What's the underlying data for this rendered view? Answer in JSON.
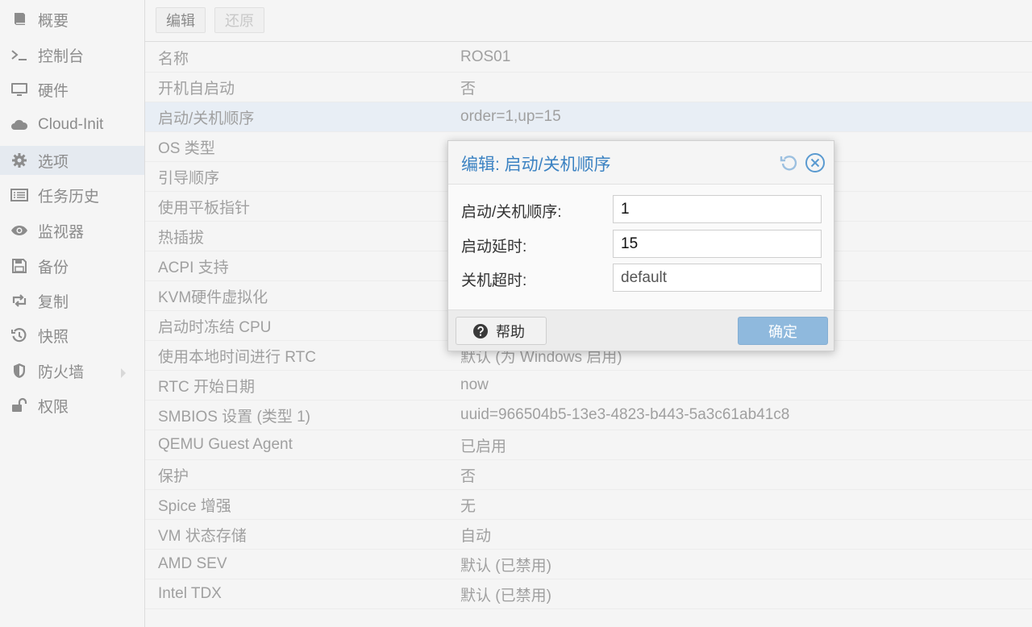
{
  "colors": {
    "accent": "#3b82c2",
    "selected_row": "#e8eef5",
    "selected_nav": "#e5eaf0",
    "ok_button": "#8fb9dd",
    "muted_text": "#a0a0a0"
  },
  "sidebar": {
    "items": [
      {
        "label": "概要",
        "icon": "book-icon"
      },
      {
        "label": "控制台",
        "icon": "terminal-icon"
      },
      {
        "label": "硬件",
        "icon": "monitor-icon"
      },
      {
        "label": "Cloud-Init",
        "icon": "cloud-icon"
      },
      {
        "label": "选项",
        "icon": "gear-icon",
        "selected": true
      },
      {
        "label": "任务历史",
        "icon": "list-icon"
      },
      {
        "label": "监视器",
        "icon": "eye-icon"
      },
      {
        "label": "备份",
        "icon": "floppy-icon"
      },
      {
        "label": "复制",
        "icon": "retweet-icon"
      },
      {
        "label": "快照",
        "icon": "history-icon"
      },
      {
        "label": "防火墙",
        "icon": "shield-icon",
        "has_submenu": true
      },
      {
        "label": "权限",
        "icon": "unlock-icon"
      }
    ]
  },
  "toolbar": {
    "edit_label": "编辑",
    "revert_label": "还原"
  },
  "options": {
    "rows": [
      {
        "key": "名称",
        "value": "ROS01"
      },
      {
        "key": "开机自启动",
        "value": "否"
      },
      {
        "key": "启动/关机顺序",
        "value": "order=1,up=15",
        "selected": true
      },
      {
        "key": "OS 类型",
        "value": ""
      },
      {
        "key": "引导顺序",
        "value": ""
      },
      {
        "key": "使用平板指针",
        "value": ""
      },
      {
        "key": "热插拔",
        "value": ""
      },
      {
        "key": "ACPI 支持",
        "value": ""
      },
      {
        "key": "KVM硬件虚拟化",
        "value": ""
      },
      {
        "key": "启动时冻结 CPU",
        "value": ""
      },
      {
        "key": "使用本地时间进行 RTC",
        "value": "默认 (为 Windows 启用)"
      },
      {
        "key": "RTC 开始日期",
        "value": "now"
      },
      {
        "key": "SMBIOS 设置 (类型 1)",
        "value": "uuid=966504b5-13e3-4823-b443-5a3c61ab41c8"
      },
      {
        "key": "QEMU Guest Agent",
        "value": "已启用"
      },
      {
        "key": "保护",
        "value": "否"
      },
      {
        "key": "Spice 增强",
        "value": "无"
      },
      {
        "key": "VM 状态存储",
        "value": "自动"
      },
      {
        "key": "AMD SEV",
        "value": "默认 (已禁用)"
      },
      {
        "key": "Intel TDX",
        "value": "默认 (已禁用)"
      }
    ]
  },
  "dialog": {
    "title": "编辑: 启动/关机顺序",
    "fields": [
      {
        "label": "启动/关机顺序:",
        "value": "1"
      },
      {
        "label": "启动延时:",
        "value": "15"
      },
      {
        "label": "关机超时:",
        "value": "default"
      }
    ],
    "help_label": "帮助",
    "ok_label": "确定"
  }
}
